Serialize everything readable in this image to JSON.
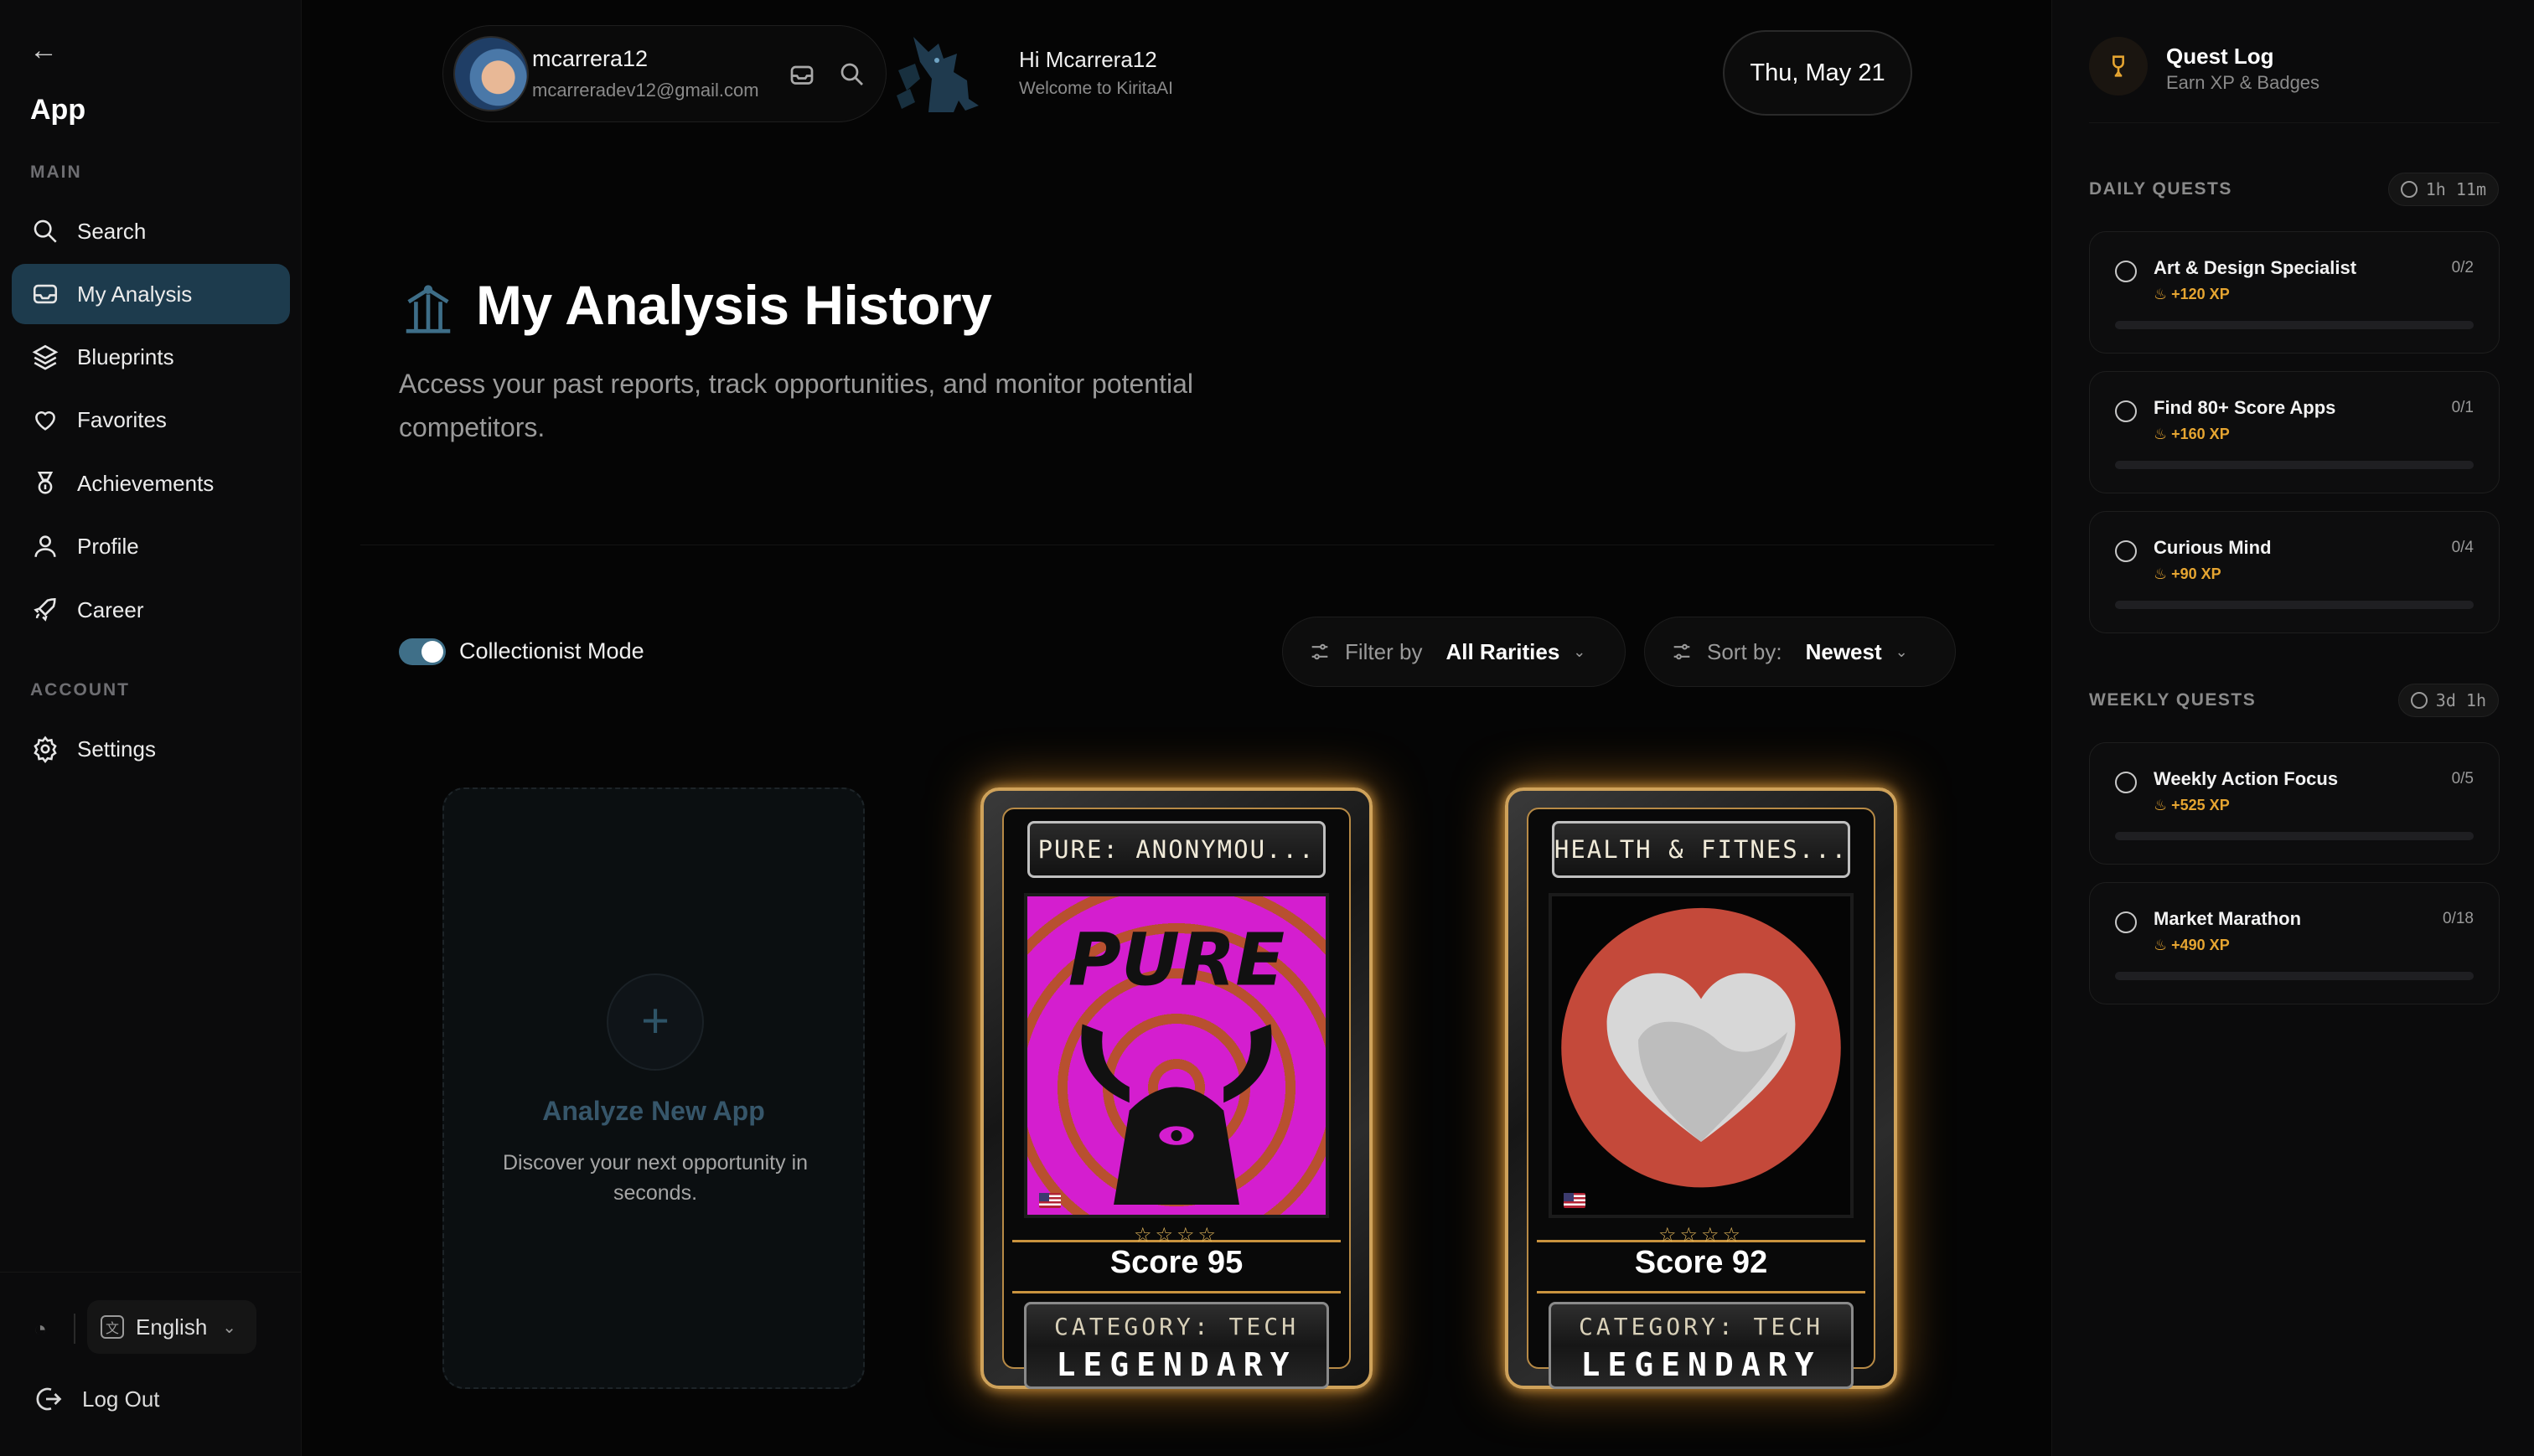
{
  "sidebar": {
    "title": "App",
    "main_label": "MAIN",
    "account_label": "ACCOUNT",
    "items": [
      {
        "label": "Search",
        "icon": "search-icon"
      },
      {
        "label": "My Analysis",
        "icon": "inbox-icon",
        "active": true
      },
      {
        "label": "Blueprints",
        "icon": "layers-icon"
      },
      {
        "label": "Favorites",
        "icon": "heart-icon"
      },
      {
        "label": "Achievements",
        "icon": "medal-icon"
      },
      {
        "label": "Profile",
        "icon": "user-icon"
      },
      {
        "label": "Career",
        "icon": "rocket-icon"
      }
    ],
    "account_items": [
      {
        "label": "Settings",
        "icon": "gear-icon"
      }
    ],
    "language": "English",
    "logout_label": "Log Out"
  },
  "header": {
    "user_name": "mcarrera12",
    "user_email": "mcarreradev12@gmail.com",
    "greeting": "Hi Mcarrera12",
    "welcome": "Welcome to KiritaAI",
    "date": "Thu, May 21"
  },
  "main": {
    "title": "My Analysis History",
    "description": "Access your past reports, track opportunities, and monitor potential competitors.",
    "collectionist_label": "Collectionist Mode",
    "collectionist_on": true,
    "filter_label": "Filter by",
    "filter_value": "All Rarities",
    "sort_label": "Sort by:",
    "sort_value": "Newest",
    "new_card": {
      "title": "Analyze New App",
      "description": "Discover your next opportunity in seconds."
    },
    "cards": [
      {
        "name": "PURE: ANONYMOU...",
        "art_text": "PURE",
        "score": "Score 95",
        "stars": "☆☆☆☆",
        "category": "CATEGORY: TECH",
        "rarity": "LEGENDARY"
      },
      {
        "name": "HEALTH & FITNES...",
        "score": "Score 92",
        "stars": "☆☆☆☆",
        "category": "CATEGORY: TECH",
        "rarity": "LEGENDARY"
      }
    ]
  },
  "quests": {
    "title": "Quest Log",
    "subtitle": "Earn XP & Badges",
    "daily_label": "DAILY QUESTS",
    "daily_timer": "1h 11m",
    "weekly_label": "WEEKLY QUESTS",
    "weekly_timer": "3d 1h",
    "daily": [
      {
        "name": "Art & Design Specialist",
        "xp": "+120 XP",
        "count": "0/2",
        "progress": 0
      },
      {
        "name": "Find 80+ Score Apps",
        "xp": "+160 XP",
        "count": "0/1",
        "progress": 0
      },
      {
        "name": "Curious Mind",
        "xp": "+90 XP",
        "count": "0/4",
        "progress": 0
      }
    ],
    "weekly": [
      {
        "name": "Weekly Action Focus",
        "xp": "+525 XP",
        "count": "0/5",
        "progress": 0
      },
      {
        "name": "Market Marathon",
        "xp": "+490 XP",
        "count": "0/18",
        "progress": 0
      }
    ]
  },
  "colors": {
    "accent": "#1d3b4d",
    "xp": "#e6a531",
    "card_glow": "#ffa028"
  }
}
